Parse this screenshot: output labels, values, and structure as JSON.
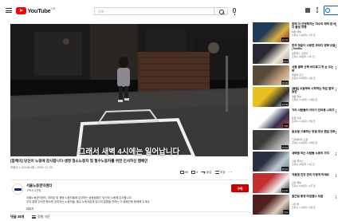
{
  "header": {
    "logo_text": "YouTube",
    "logo_region": "KR",
    "search_placeholder": "검색"
  },
  "player": {
    "caption": "그래서 새벽 4시에는 일어납니다"
  },
  "video": {
    "title": "[참혜의] 당신이 노동에 감사합니다-생명 청소노동자 및 필수노동자를 위한 인사하신 캠페인",
    "meta": "조회수 1,215,814회 • 2020. 11. 20.",
    "likes": "9K",
    "dislikes": "4",
    "share": "공유",
    "save": "저장",
    "more": "···"
  },
  "channel": {
    "name": "서울노동권익센터",
    "subscribers": "구독자 3천명",
    "subscribe_label": "구독",
    "description_line1": "서울노동권익센터, 여러분 및 생명 노동자들께 감사하는 공동캠페인 '당신의 노동에 감사합니다'.",
    "description_line2": "우리 곁에 있지만 평소엔 잊혀지는 노동자들, 필수 노동자분께 감사의 말씀을 전하는 이 캠페인에 함께해 주세요.",
    "show_more": "더보기"
  },
  "comments": {
    "count_label": "댓글 38개",
    "sort_label": "정렬 기준"
  },
  "recommendations": [
    {
      "title": "밤에 더 선명해지는 여수의 매력 밤 바다 불빛 여행",
      "channel": "여행 채널",
      "meta": "조회수 1.2만회 • 1주 전",
      "duration": "12:34",
      "palette": [
        "#203a5a",
        "#d8b040",
        "#7a2a2a"
      ]
    },
    {
      "title": "한국 청춘이 사랑한 코미디 영화 모음 | Netflix",
      "channel": "넷플릭스 코리아",
      "meta": "조회수 33만회 • 2주 전",
      "duration": "8:12",
      "palette": [
        "#2a2a30",
        "#f0e8d8",
        "#a0a0a8"
      ]
    },
    {
      "title": "서울 골목 산책 브이로그 첫 눈 오는 날",
      "channel": "데일리 로그",
      "meta": "조회수 8.9천회 • 3일 전",
      "duration": "15:02",
      "palette": [
        "#5a4a3a",
        "#c0a080",
        "#e8e0d0"
      ]
    },
    {
      "title": "[꿀팁] 오늘부터 시작하는 작은 절약 습관",
      "channel": "생활 정보",
      "meta": "조회수 4.7만회 • 1개월 전",
      "duration": "10:45",
      "palette": [
        "#e8c020",
        "#303030",
        "#f4f4f4"
      ]
    },
    {
      "title": "거리 사람들의 이야기 인터뷰 시리즈",
      "channel": "휴먼 다큐",
      "meta": "조회수 2.1만회 • 5일 전",
      "duration": "7:58",
      "palette": [
        "#ffffff",
        "#303050",
        "#d04040"
      ]
    },
    {
      "title": "일상을 기록하는 방법 영상 편집 강좌",
      "channel": "크리에이터 스쿨",
      "meta": "조회수 6.3만회 • 2개월 전",
      "duration": "21:16",
      "palette": [
        "#3a3a3a",
        "#a0a0a0",
        "#e0e0e0"
      ]
    },
    {
      "title": "새벽을 여는 사람들 노동의 가치",
      "channel": "다큐 플러스",
      "meta": "조회수 15만회 • 1년 전",
      "duration": "45:10",
      "palette": [
        "#2a3040",
        "#c0c8d0",
        "#608090"
      ]
    },
    {
      "title": "겨울철 건강 관리 이렇게 하세요",
      "channel": "건강 채널",
      "meta": "조회수 9.8만회 • 3주 전",
      "duration": "11:20",
      "palette": [
        "#c03030",
        "#f0f0f0",
        "#202020"
      ]
    },
    {
      "title": "출근길 풍경 타임랩스 모음",
      "channel": "시티 뷰",
      "meta": "조회수 1.1만회 • 6일 전",
      "duration": "5:44",
      "palette": [
        "#502020",
        "#e0d0c0",
        "#303030"
      ]
    }
  ]
}
